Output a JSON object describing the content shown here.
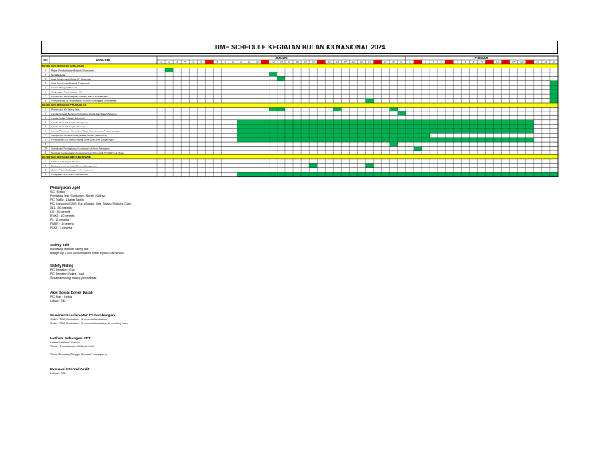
{
  "title": "TIME SCHEDULE KEGIATAN BULAN K3 NASIONAL 2024",
  "header": {
    "no": "NO",
    "kegiatan": "KEGIATAN",
    "months": [
      "JANUARI",
      "FEBRUARI"
    ]
  },
  "days": [
    "1",
    "2",
    "3",
    "4",
    "5",
    "6",
    "7",
    "8",
    "9",
    "10",
    "11",
    "12",
    "13",
    "14",
    "15",
    "16",
    "17",
    "18",
    "19",
    "20",
    "21",
    "22",
    "23",
    "24",
    "25",
    "26",
    "27",
    "28",
    "29",
    "30",
    "31",
    "1",
    "2",
    "3",
    "4",
    "5",
    "6",
    "7",
    "8",
    "9",
    "10",
    "11",
    "12",
    "13",
    "14",
    "15",
    "16",
    "17",
    "18",
    "19"
  ],
  "holidays": [
    7,
    14,
    21,
    28,
    33,
    37,
    42,
    44,
    47
  ],
  "colors": {
    "section": "#ffff00",
    "active": "#00b050",
    "holiday": "#ff0000",
    "border": "#000000"
  },
  "sections": [
    {
      "label": "KEGIATAN BERSIFAT STRATEGIS",
      "rows": [
        {
          "no": "1",
          "kegiatan": "Rapat Pembahasan Bulan K3 Nasional",
          "active": [
            2
          ]
        },
        {
          "no": "2",
          "kegiatan": "Surat Edaran",
          "active": [
            15
          ]
        },
        {
          "no": "3",
          "kegiatan": "Apel Pembukaan Bulan K3 Nasional",
          "active": [
            16
          ]
        },
        {
          "no": "4",
          "kegiatan": "Apel Penutupan Bulan K3 Nasional",
          "active": [
            50
          ]
        },
        {
          "no": "5",
          "kegiatan": "Inisiasi Tanggap Darurat",
          "active": [
            50
          ]
        },
        {
          "no": "6",
          "kegiatan": "Kunjungan Penghargaan K3",
          "active": [
            50
          ]
        },
        {
          "no": "7",
          "kegiatan": "Pemberian Penghargaan Inisiatif atau Pemenangan",
          "active": [
            50
          ]
        },
        {
          "no": "8",
          "kegiatan": "Pembahasan & Pembekalan Komite Investigasi Kecelakaan",
          "active": [
            27,
            50
          ]
        }
      ]
    },
    {
      "label": "KEGIATAN BERSIFAT PROMOSI K3",
      "rows": [
        {
          "no": "1",
          "kegiatan": "Pemberian K3 Safety Talk",
          "active": [
            15,
            16,
            23,
            30
          ]
        },
        {
          "no": "2",
          "kegiatan": "Lomba Inovasi Bertema Kelompok Kerja dan Safety Sharing",
          "active": [
            31
          ]
        },
        {
          "no": "3",
          "kegiatan": "Lomba Video \"Safety Induction\"",
          "active": []
        },
        {
          "no": "4",
          "kegiatan": "Lomba Kuis K3 Tingkat Pengawas",
          "active": [
            11,
            12,
            13,
            14,
            15,
            16,
            17,
            18,
            19,
            20,
            21,
            22,
            23,
            24,
            25,
            26,
            27,
            28,
            29,
            30,
            31,
            32,
            33,
            34,
            35,
            36,
            37,
            38,
            39,
            40,
            41,
            42,
            43,
            44,
            45,
            46,
            47
          ]
        },
        {
          "no": "5",
          "kegiatan": "Lomba Kuis K3 Tingkat Pekerja",
          "active": [
            11,
            12,
            13,
            14,
            15,
            16,
            17,
            18,
            19,
            20,
            21,
            22,
            23,
            24,
            25,
            26,
            27,
            28,
            29,
            30,
            31,
            32,
            33,
            34,
            35,
            36,
            37,
            38,
            39,
            40,
            41,
            42,
            43,
            44,
            45,
            46,
            47
          ]
        },
        {
          "no": "6",
          "kegiatan": "Lomba Penulisan Kreatifitas Tepat Keselamatan Pertambangan",
          "active": [
            11,
            12,
            13,
            14,
            15,
            16,
            17,
            18,
            19,
            20,
            21,
            22,
            23,
            24,
            25,
            26,
            27,
            28,
            29,
            30,
            31,
            32,
            33,
            34,
            35,
            36,
            37,
            38,
            39,
            40,
            41,
            42,
            43,
            44,
            45,
            46,
            47
          ]
        },
        {
          "no": "7",
          "kegiatan": "Kampanye Gerakan Masyarakat Peduli (GERMAS)",
          "active": [
            11,
            12,
            13,
            14,
            15,
            16,
            17,
            18,
            19,
            20,
            21,
            22,
            23,
            24,
            25,
            26,
            27,
            28,
            29,
            30,
            31,
            32,
            33,
            34
          ]
        },
        {
          "no": "8",
          "kegiatan": "Penyuluhan K3 Safety Riding (SMK3) di Area Lingkungan",
          "active": [
            11,
            12,
            13,
            14,
            15,
            16,
            17,
            18,
            19,
            20,
            21,
            22,
            23,
            24,
            25,
            26,
            27,
            28,
            29,
            30,
            31,
            32,
            33,
            34,
            35,
            36,
            37,
            38,
            39,
            40,
            41,
            42,
            43,
            44,
            45,
            46,
            47
          ]
        },
        {
          "no": "9",
          "kegiatan": "",
          "active": [
            30
          ]
        },
        {
          "no": "10",
          "kegiatan": "Sosialisasi Peningkatan Kesehatan di Area Pekerjaan",
          "active": [
            33
          ]
        },
        {
          "no": "11",
          "kegiatan": "Seminar Keselamatan Pertambangan (Penyakit TT/DDR) via Zoom",
          "active": []
        }
      ]
    },
    {
      "label": "KEGIATAN BERSIFAT IMPLEMENTATIF",
      "rows": [
        {
          "no": "1",
          "kegiatan": "Latihan Gabungan Rescue",
          "active": []
        },
        {
          "no": "2",
          "kegiatan": "Evaluasi Internal Audit Sistem Manajemen",
          "active": [
            20,
            27
          ]
        },
        {
          "no": "3",
          "kegiatan": "Safety Patrol Gabungan / Tim Inspeksi",
          "active": []
        },
        {
          "no": "4",
          "kegiatan": "Pengujian APD (Laik Operasional)",
          "active": [
            11,
            12,
            13,
            14,
            15,
            16,
            17,
            18,
            19,
            20,
            21,
            22,
            23,
            24,
            25,
            26,
            27,
            28,
            29,
            30,
            31,
            32,
            33,
            34,
            35,
            36,
            37,
            38,
            39,
            40,
            41,
            42,
            43,
            44,
            45,
            46,
            47,
            48,
            49,
            50
          ]
        }
      ]
    }
  ],
  "notes": [
    {
      "heading": "Penunjukan Apel",
      "lines": [
        "SIC : Ketika",
        "Pembawa Teks Sambutan : Nuraih / Wahyu",
        "PIC Traffic : Lisabar Taufik",
        "PIC Konsumsi (100) : Eut, Widaad, Dela, Nahyu, Ratharo, Catur",
        "SKL : 50 peserta",
        "LKI : 50 peserta",
        "RMKS : 10 peserta",
        "FI : 10 peserta",
        "FBBU : 15 peserta",
        "FKKP : 5 peserta"
      ]
    },
    {
      "heading": "Safety Talk",
      "lines": [
        "Bandakup Masuan Safety Talk",
        "Budget Rp 1.000.000/kontraktor untuk tepatulu dan snack"
      ]
    },
    {
      "heading": "Safety Riding",
      "lines": [
        "PIC Pemateri : Eva",
        "PIC Pemateri Polres : Yudi",
        "Sesama masing masing perusahaan"
      ]
    },
    {
      "heading": "Aksi Sosial Donor Darah",
      "lines": [
        "PIC Plan : Ketika",
        "Lokasi : SKL"
      ]
    },
    {
      "heading": "Seminar Keselamatan Pertambangan",
      "lines": [
        "Offline TSO Kontraktor : 5 peserta/kontraktor",
        "Online TSO Kontraktor : 5 peserta/kontraktor di meeting room"
      ]
    },
    {
      "heading": "Latihan Gabungan ERT",
      "lines": [
        "Lokasi Latihan : Kurumi",
        "Tema : Pemadamam di Cabin Unit",
        "",
        "Tema Simulasi (Tanggal Darurat Penutupan)"
      ]
    },
    {
      "heading": "Evaluasi Internal Audit",
      "lines": [
        "Lokasi : SKL"
      ]
    }
  ]
}
